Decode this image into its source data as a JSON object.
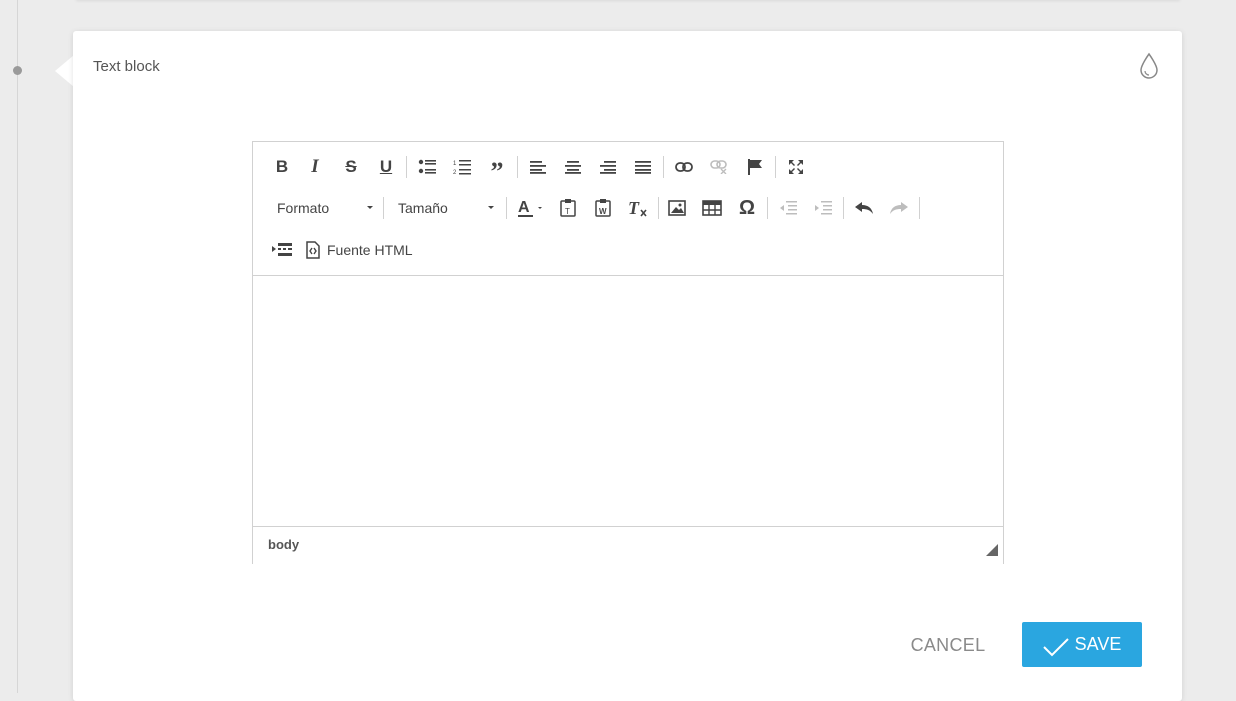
{
  "panel": {
    "title": "Text block",
    "style_icon": "drop-icon"
  },
  "editor": {
    "toolbar_row1": [
      "bold",
      "italic",
      "strike",
      "underline",
      "bulleted-list",
      "numbered-list",
      "blockquote",
      "align-left",
      "align-center",
      "align-right",
      "justify",
      "link",
      "unlink",
      "anchor",
      "maximize"
    ],
    "format_combo": "Formato",
    "size_combo": "Tamaño",
    "source_label": "Fuente HTML",
    "element_path": "body",
    "content": ""
  },
  "actions": {
    "cancel_label": "CANCEL",
    "save_label": "SAVE"
  },
  "colors": {
    "accent": "#2aa6e0",
    "icon": "#444444",
    "disabled": "#bdbdbd"
  }
}
